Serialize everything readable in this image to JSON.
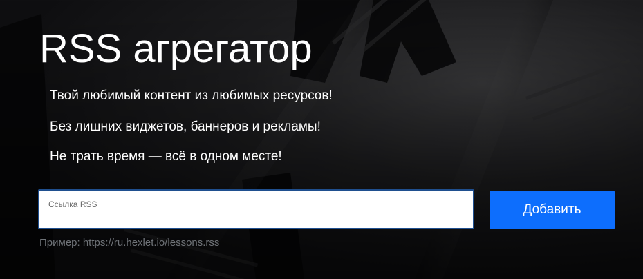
{
  "header": {
    "title": "RSS агрегатор",
    "lead_lines": [
      "Твой любимый контент из любимых ресурсов!",
      "Без лишних виджетов, баннеров и рекламы!",
      "Не трать время — всё в одном месте!"
    ]
  },
  "form": {
    "input_label": "Ссылка RSS",
    "input_value": "",
    "submit_label": "Добавить",
    "example": "Пример: https://ru.hexlet.io/lessons.rss"
  },
  "colors": {
    "accent": "#0d6efd",
    "background": "#111111",
    "text": "#ffffff",
    "muted": "#6f7378"
  },
  "icons": {
    "background": "newspaper-background-image"
  }
}
